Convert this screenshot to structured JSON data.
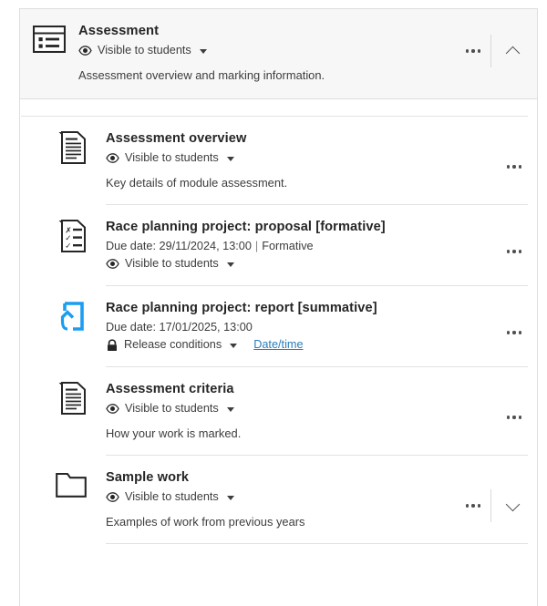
{
  "colors": {
    "accent_blue": "#1b9df0",
    "link_blue": "#2b7cb9",
    "header_bg": "#f7f7f7",
    "border": "#dedede",
    "text": "#262626",
    "muted_text": "#3d3d3d"
  },
  "folder": {
    "title": "Assessment",
    "icon": "content-list-icon",
    "visibility": "Visible to students",
    "description": "Assessment overview and marking information.",
    "more_label": "More options",
    "collapse_label": "Collapse"
  },
  "items": [
    {
      "icon": "document-page-icon",
      "title": "Assessment overview",
      "visibility": "Visible to students",
      "description": "Key details of module assessment.",
      "more_label": "More options"
    },
    {
      "icon": "checklist-test-icon",
      "title": "Race planning project: proposal [formative]",
      "due_label": "Due date: 29/11/2024, 13:00",
      "separator": "|",
      "assessment_type": "Formative",
      "visibility": "Visible to students",
      "more_label": "More options"
    },
    {
      "icon": "turnitin-submission-icon",
      "title": "Race planning project: report [summative]",
      "due_label": "Due date: 17/01/2025, 13:00",
      "release": "Release conditions",
      "release_link": "Date/time",
      "more_label": "More options"
    },
    {
      "icon": "document-page-icon",
      "title": "Assessment criteria",
      "visibility": "Visible to students",
      "description": "How your work is marked.",
      "more_label": "More options"
    },
    {
      "icon": "folder-icon",
      "title": "Sample work",
      "visibility": "Visible to students",
      "description": "Examples of work from previous years",
      "more_label": "More options",
      "expand_label": "Expand"
    }
  ]
}
